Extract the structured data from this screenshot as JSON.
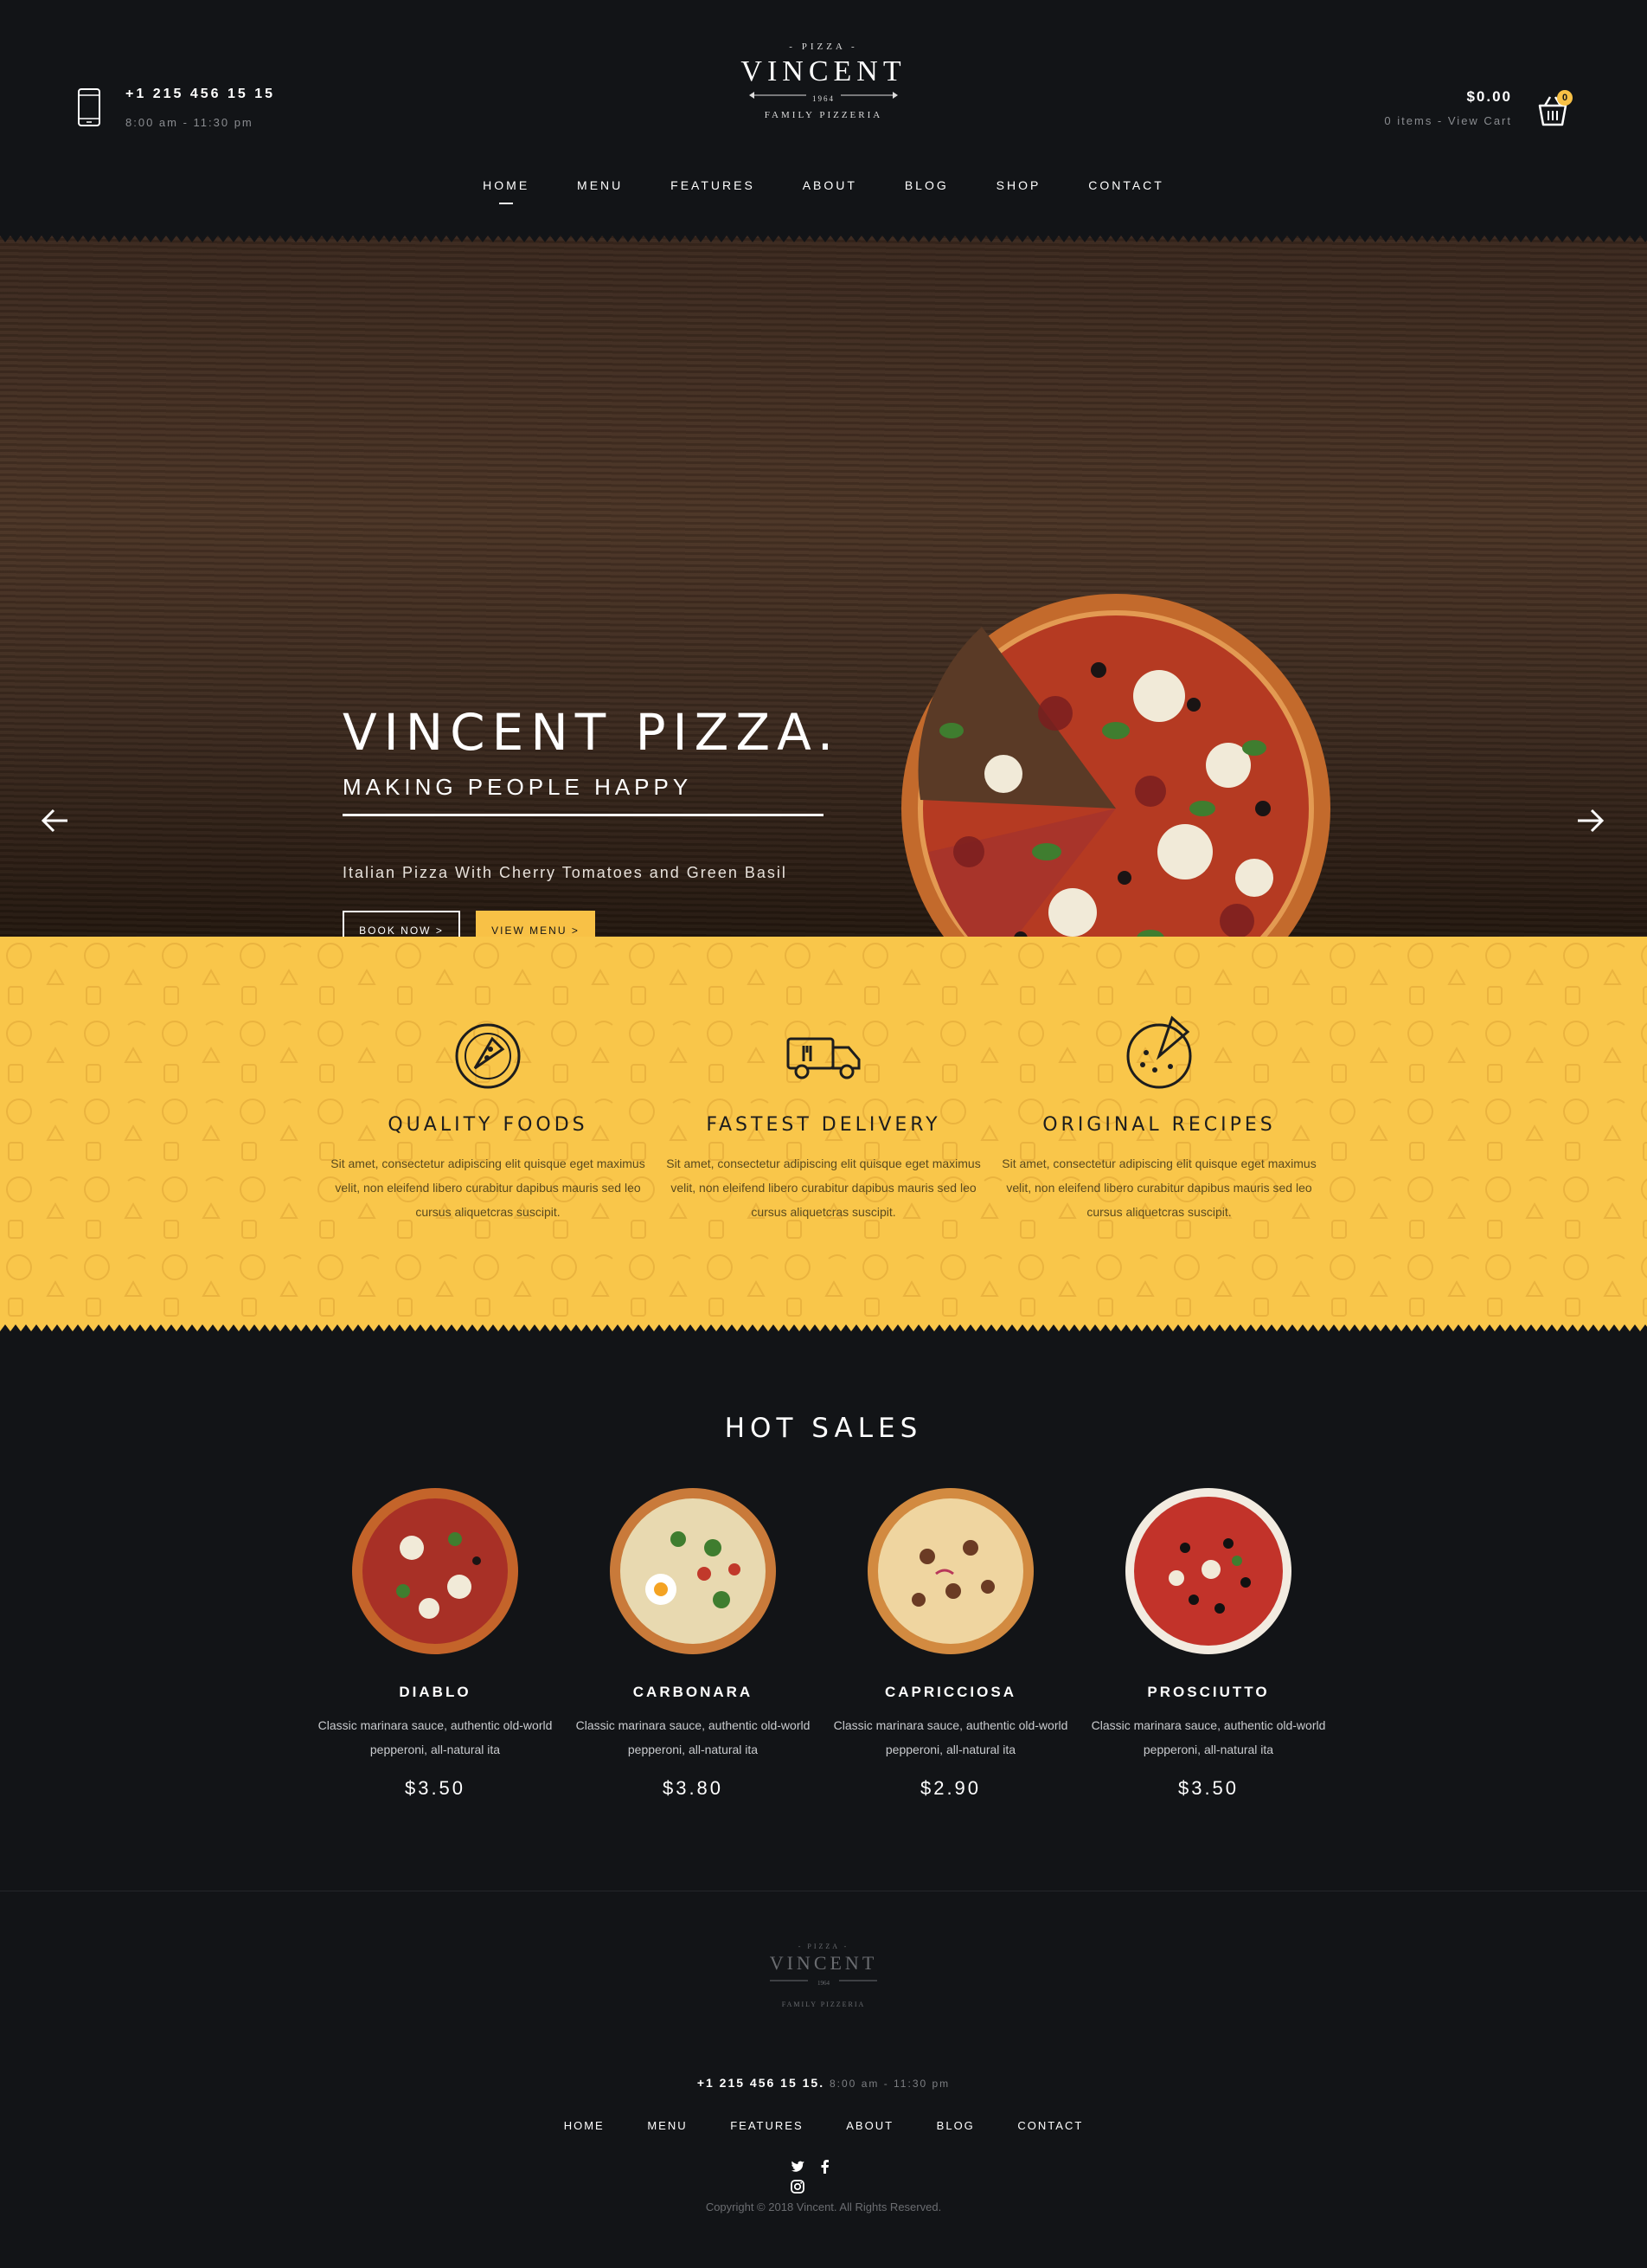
{
  "header": {
    "phone": "+1 215 456 15 15",
    "hours": "8:00 am - 11:30 pm",
    "logo": {
      "top": "- PIZZA -",
      "name": "VINCENT",
      "year": "1964",
      "bottom": "FAMILY PIZZERIA"
    },
    "cart_total": "$0.00",
    "cart_items": "0 items - View Cart",
    "cart_count": "0"
  },
  "nav": {
    "items": [
      {
        "label": "HOME"
      },
      {
        "label": "MENU"
      },
      {
        "label": "FEATURES"
      },
      {
        "label": "ABOUT"
      },
      {
        "label": "BLOG"
      },
      {
        "label": "SHOP"
      },
      {
        "label": "CONTACT"
      }
    ]
  },
  "hero": {
    "title": "VINCENT PIZZA.",
    "subtitle": "MAKING PEOPLE HAPPY",
    "description": "Italian Pizza With Cherry Tomatoes and Green Basil",
    "book_label": "BOOK NOW  >",
    "menu_label": "VIEW MENU  >"
  },
  "features": [
    {
      "title": "QUALITY FOODS",
      "text": "Sit amet, consectetur adipiscing elit quisque eget maximus velit, non eleifend libero curabitur dapibus mauris sed leo cursus aliquetcras suscipit."
    },
    {
      "title": "FASTEST DELIVERY",
      "text": "Sit amet, consectetur adipiscing elit quisque eget maximus velit, non eleifend libero curabitur dapibus mauris sed leo cursus aliquetcras suscipit."
    },
    {
      "title": "ORIGINAL RECIPES",
      "text": "Sit amet, consectetur adipiscing elit quisque eget maximus velit, non eleifend libero curabitur dapibus mauris sed leo cursus aliquetcras suscipit."
    }
  ],
  "hot_sales": {
    "title": "HOT SALES",
    "products": [
      {
        "name": "DIABLO",
        "desc": "Classic marinara sauce, authentic old-world pepperoni, all-natural ita",
        "price": "$3.50"
      },
      {
        "name": "CARBONARA",
        "desc": "Classic marinara sauce, authentic old-world pepperoni, all-natural ita",
        "price": "$3.80"
      },
      {
        "name": "CAPRICCIOSA",
        "desc": "Classic marinara sauce, authentic old-world pepperoni, all-natural ita",
        "price": "$2.90"
      },
      {
        "name": "PROSCIUTTO",
        "desc": "Classic marinara sauce, authentic old-world pepperoni, all-natural ita",
        "price": "$3.50"
      }
    ]
  },
  "footer": {
    "logo": {
      "top": "- PIZZA -",
      "name": "VINCENT",
      "year": "1964",
      "bottom": "FAMILY PIZZERIA"
    },
    "phone": "+1 215 456 15 15.",
    "hours": "8:00 am - 11:30 pm",
    "nav": [
      {
        "label": "HOME"
      },
      {
        "label": "MENU"
      },
      {
        "label": "FEATURES"
      },
      {
        "label": "ABOUT"
      },
      {
        "label": "BLOG"
      },
      {
        "label": "CONTACT"
      }
    ],
    "social": [
      "twitter-icon",
      "facebook-icon",
      "instagram-icon"
    ],
    "copyright": "Copyright © 2018 Vincent. All Rights Reserved."
  },
  "colors": {
    "background": "#121417",
    "accent": "#f8c146",
    "features_bg": "#f9c64a",
    "text": "#ffffff"
  }
}
